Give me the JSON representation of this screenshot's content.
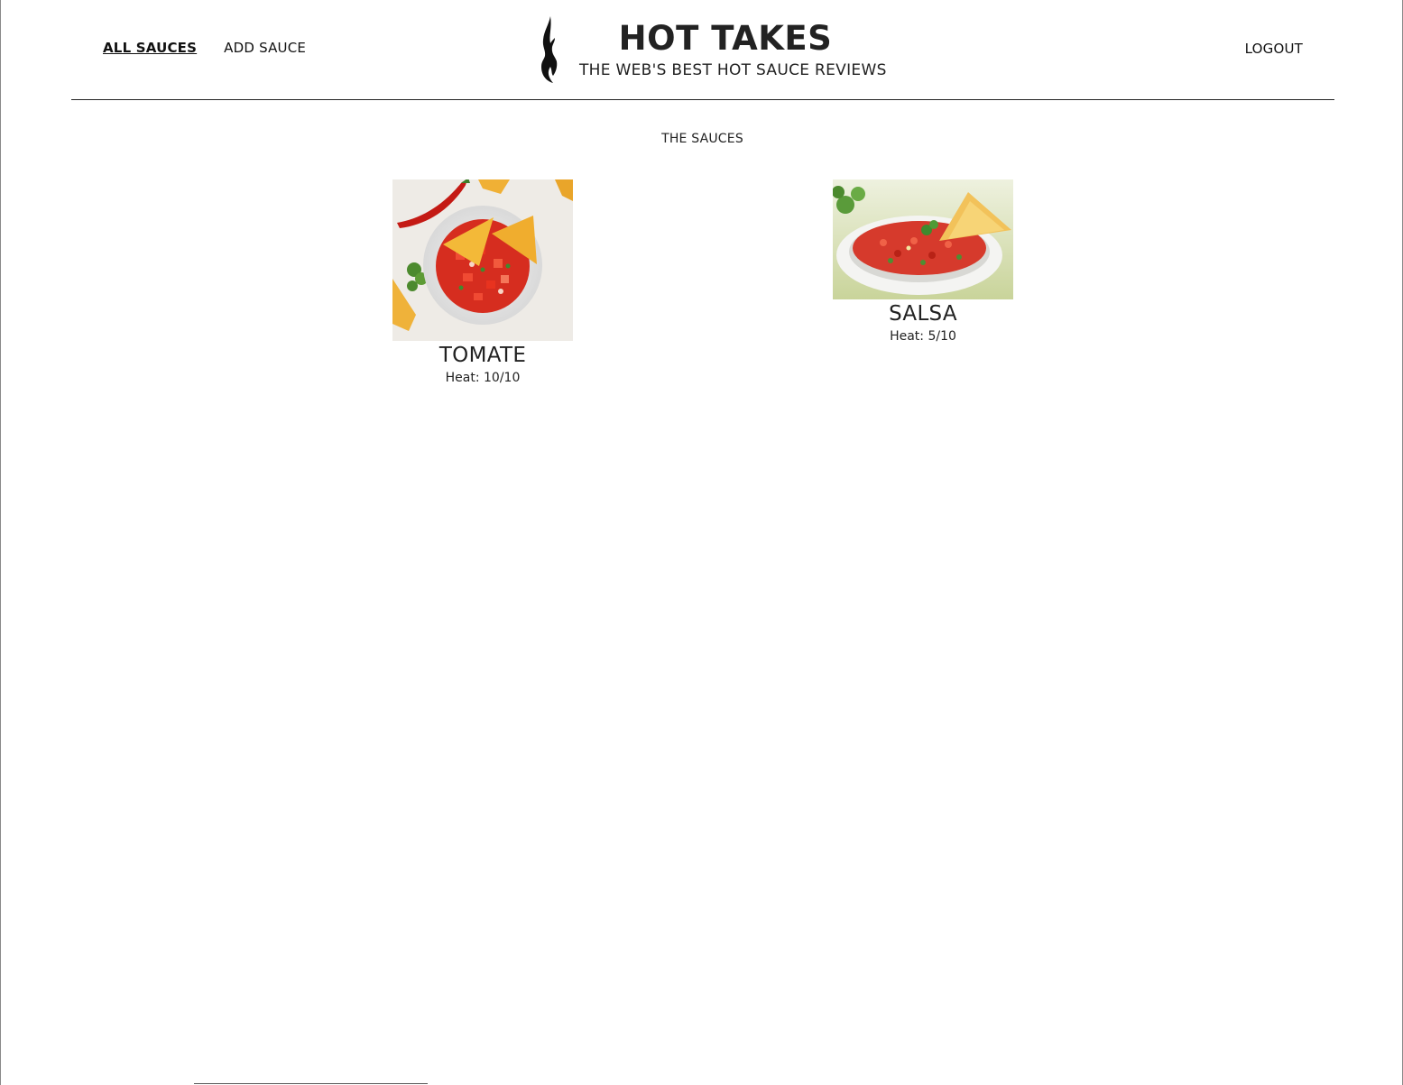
{
  "header": {
    "nav_left": [
      {
        "label": "ALL SAUCES",
        "active": true
      },
      {
        "label": "ADD SAUCE",
        "active": false
      }
    ],
    "logout_label": "LOGOUT",
    "brand": {
      "title": "HOT TAKES",
      "subtitle": "THE WEB'S BEST HOT SAUCE REVIEWS",
      "logo_icon": "flame-icon"
    }
  },
  "main": {
    "heading": "THE SAUCES",
    "sauces": [
      {
        "name": "TOMATE",
        "heat": "Heat: 10/10",
        "image": "tomato-salsa-bowl-photo"
      },
      {
        "name": "SALSA",
        "heat": "Heat: 5/10",
        "image": "salsa-dish-photo"
      }
    ]
  },
  "colors": {
    "text": "#222222",
    "background": "#ffffff",
    "divider": "#222222"
  }
}
